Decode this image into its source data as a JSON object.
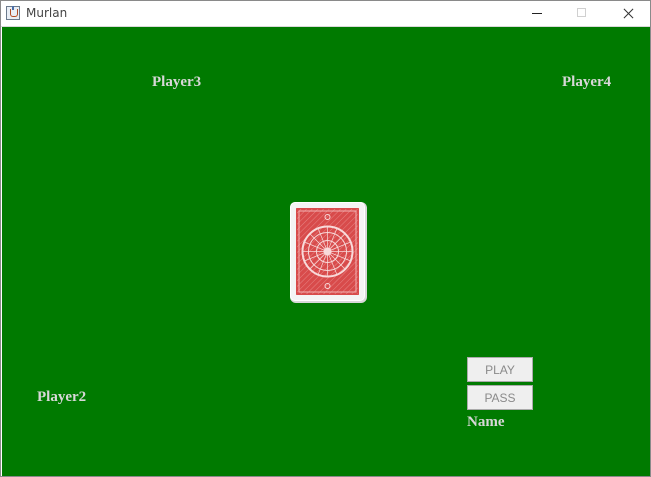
{
  "window": {
    "title": "Murlan"
  },
  "table": {
    "background_color": "#007a00",
    "players": {
      "player3": "Player3",
      "player4": "Player4",
      "player2": "Player2",
      "name": "Name"
    },
    "center_card": {
      "face": "back",
      "color": "#d84b4b"
    }
  },
  "controls": {
    "play_label": "PLAY",
    "pass_label": "PASS"
  }
}
